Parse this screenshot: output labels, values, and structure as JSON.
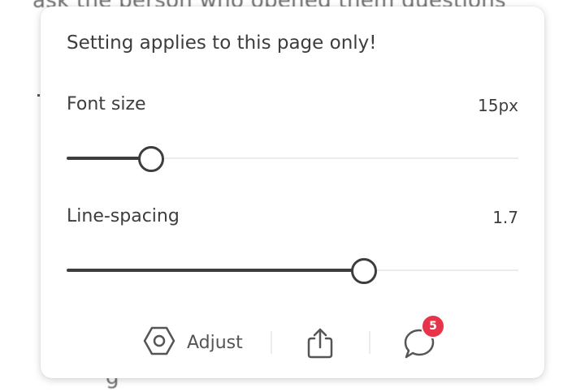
{
  "background": {
    "top_text": "ask the person who opened them questions",
    "bottom_fragment": "g"
  },
  "panel": {
    "notice": "Setting applies to this page only!",
    "font_size": {
      "label": "Font size",
      "value": "15px",
      "slider_fraction": 0.185
    },
    "line_spacing": {
      "label": "Line-spacing",
      "value": "1.7",
      "slider_fraction": 0.657
    },
    "toolbar": {
      "adjust_label": "Adjust",
      "adjust_icon": "hexagon-settings-icon",
      "share_icon": "share-icon",
      "comments_icon": "comment-bubble-icon",
      "comments_badge": "5"
    },
    "colors": {
      "text": "#3d3d3d",
      "track": "#ececec",
      "badge": "#e8344a"
    }
  }
}
